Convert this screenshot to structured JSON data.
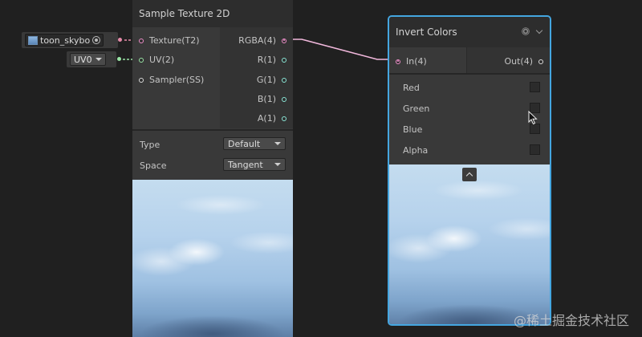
{
  "properties": {
    "texture_value": "toon_skybo",
    "uv_value": "UV0"
  },
  "sample_node": {
    "title": "Sample Texture 2D",
    "inputs": [
      {
        "label": "Texture(T2)"
      },
      {
        "label": "UV(2)"
      },
      {
        "label": "Sampler(SS)"
      }
    ],
    "outputs": [
      {
        "label": "RGBA(4)"
      },
      {
        "label": "R(1)"
      },
      {
        "label": "G(1)"
      },
      {
        "label": "B(1)"
      },
      {
        "label": "A(1)"
      }
    ],
    "settings": [
      {
        "label": "Type",
        "value": "Default"
      },
      {
        "label": "Space",
        "value": "Tangent"
      }
    ]
  },
  "invert_node": {
    "title": "Invert Colors",
    "input_label": "In(4)",
    "output_label": "Out(4)",
    "toggles": [
      {
        "label": "Red",
        "checked": false
      },
      {
        "label": "Green",
        "checked": false
      },
      {
        "label": "Blue",
        "checked": false
      },
      {
        "label": "Alpha",
        "checked": false
      }
    ]
  },
  "watermark": "@稀土掘金技术社区",
  "colors": {
    "background": "#202020",
    "node_body": "#393939",
    "node_header": "#2d2d2d",
    "selection": "#44a6e0",
    "port_vector4": "#ee8ec9",
    "port_vector2": "#9ae6a6",
    "port_vector1": "#8ce8d8"
  }
}
